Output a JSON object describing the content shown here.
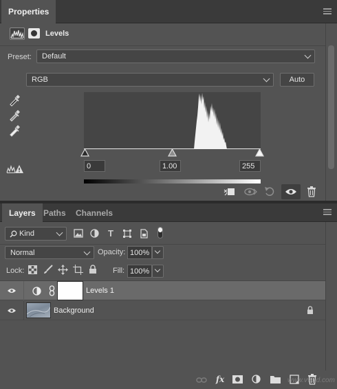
{
  "properties": {
    "tab_label": "Properties",
    "adjustment_title": "Levels",
    "preset_label": "Preset:",
    "preset_value": "Default",
    "channel_value": "RGB",
    "auto_label": "Auto",
    "input_black": "0",
    "input_gamma": "1.00",
    "input_white": "255"
  },
  "layers_panel": {
    "tabs": [
      "Layers",
      "Paths",
      "Channels"
    ],
    "filter_kind": "Kind",
    "blend_mode": "Normal",
    "opacity_label": "Opacity:",
    "opacity_value": "100%",
    "lock_label": "Lock:",
    "fill_label": "Fill:",
    "fill_value": "100%",
    "layers": [
      {
        "name": "Levels 1",
        "selected": true,
        "visible": true
      },
      {
        "name": "Background",
        "selected": false,
        "visible": true,
        "locked": true
      }
    ]
  },
  "watermark": "www.vvoid.com",
  "colors": {
    "panel_bg": "#535353",
    "tab_bar_bg": "#3a3a3a",
    "selected_layer_bg": "#6a6a6a",
    "histogram_bg": "#454545"
  }
}
